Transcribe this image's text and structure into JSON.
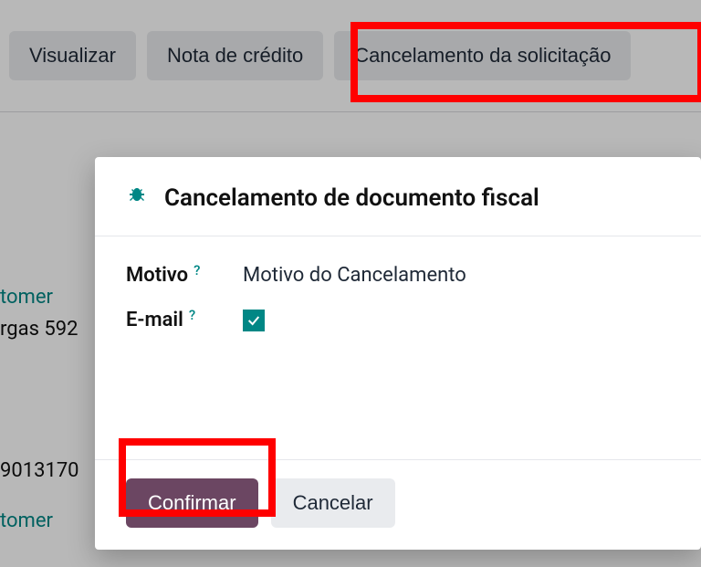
{
  "toolbar": {
    "view_label": "Visualizar",
    "credit_note_label": "Nota de crédito",
    "cancel_request_label": "Cancelamento da solicitação"
  },
  "background": {
    "link1": "tomer",
    "addr": "rgas 592",
    "num": "9013170",
    "link2": "tomer"
  },
  "modal": {
    "title": "Cancelamento de documento fiscal",
    "reason_label": "Motivo",
    "reason_value": "Motivo do Cancelamento",
    "email_label": "E-mail",
    "email_checked": true,
    "confirm_label": "Confirmar",
    "cancel_label": "Cancelar"
  }
}
